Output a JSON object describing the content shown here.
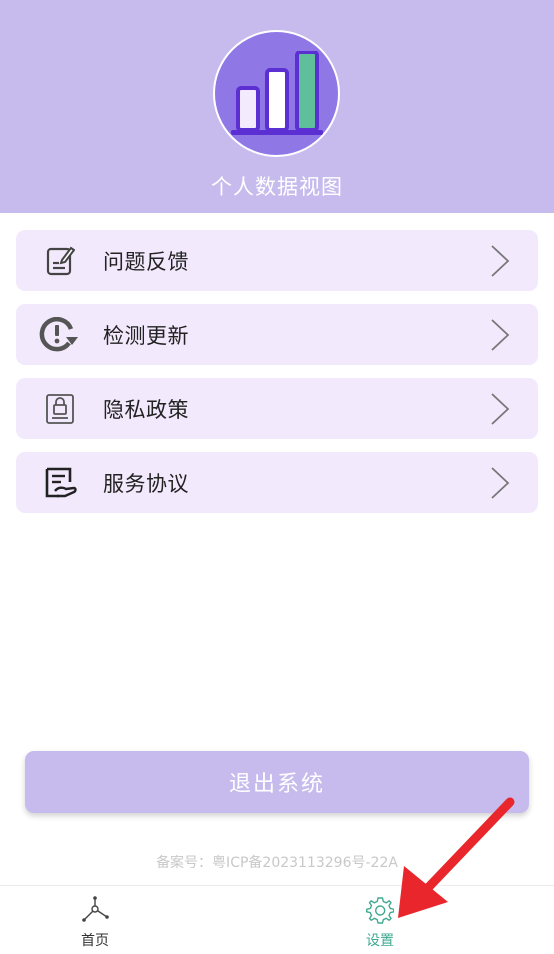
{
  "header": {
    "title": "个人数据视图",
    "background_color": "#c7bbee",
    "logo_icon": "bar-chart-icon"
  },
  "menu": {
    "items": [
      {
        "label": "问题反馈",
        "icon": "feedback-icon"
      },
      {
        "label": "检测更新",
        "icon": "check-update-icon"
      },
      {
        "label": "隐私政策",
        "icon": "privacy-lock-icon"
      },
      {
        "label": "服务协议",
        "icon": "service-agreement-icon"
      }
    ],
    "chevron_icon": "chevron-right-icon",
    "item_background": "#f3e9fd"
  },
  "logout": {
    "label": "退出系统"
  },
  "footer": {
    "icp": "备案号：粤ICP备2023113296号-22A"
  },
  "tabbar": {
    "tabs": [
      {
        "label": "首页",
        "icon": "home-network-icon",
        "active": false
      },
      {
        "label": "设置",
        "icon": "gear-icon",
        "active": true
      }
    ],
    "active_color": "#3fa990"
  },
  "annotation": {
    "icon": "red-arrow-icon",
    "color": "#e8262b"
  }
}
